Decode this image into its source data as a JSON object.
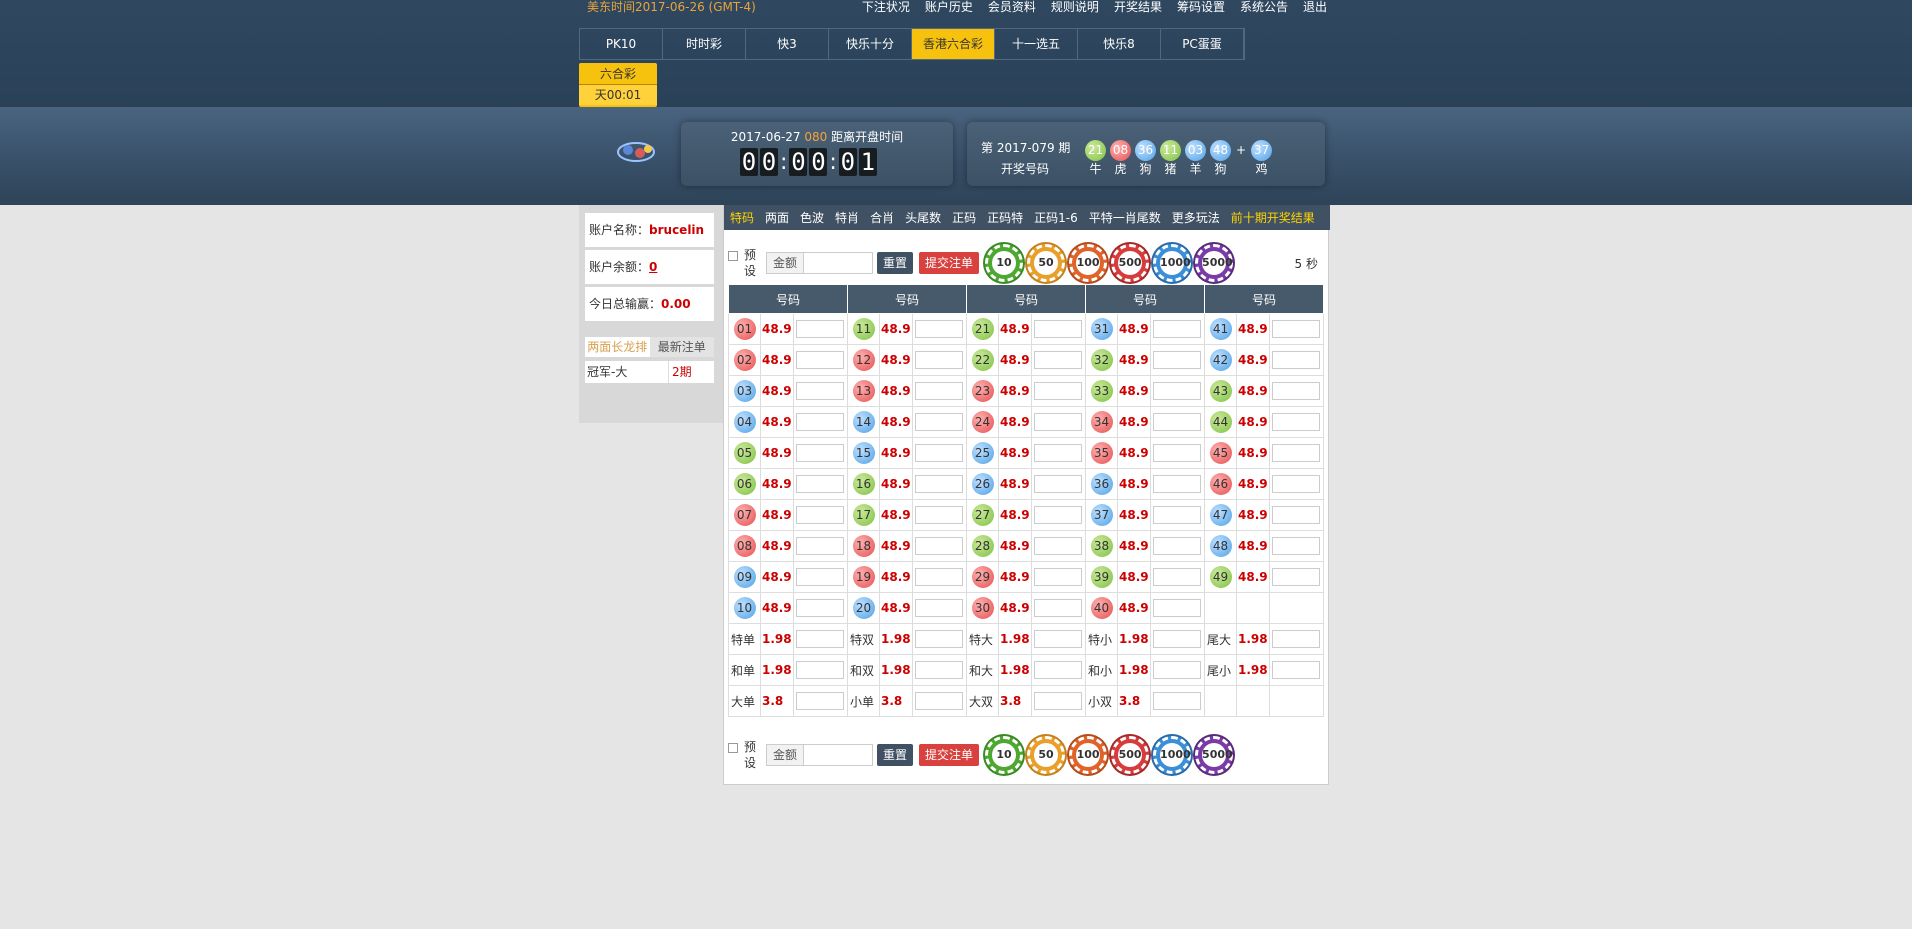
{
  "header": {
    "us_time": "美东时间2017-06-26 (GMT-4)",
    "nav": [
      "下注状况",
      "账户历史",
      "会员资料",
      "规则说明",
      "开奖结果",
      "筹码设置",
      "系统公告",
      "退出"
    ],
    "tabs": [
      "PK10",
      "时时彩",
      "快3",
      "快乐十分",
      "香港六合彩",
      "十一选五",
      "快乐8",
      "PC蛋蛋"
    ],
    "active_tab": "香港六合彩",
    "sub_tab": {
      "label": "六合彩",
      "time": "天00:01"
    }
  },
  "countdown": {
    "date": "2017-06-27",
    "period": "080",
    "label": "距离开盘时间",
    "digits": [
      "0",
      "0",
      "0",
      "0",
      "0",
      "1"
    ]
  },
  "result": {
    "title": "第 2017-079 期",
    "subtitle": "开奖号码",
    "balls": [
      {
        "num": "21",
        "zodiac": "牛",
        "color": "g"
      },
      {
        "num": "08",
        "zodiac": "虎",
        "color": "r"
      },
      {
        "num": "36",
        "zodiac": "狗",
        "color": "bl"
      },
      {
        "num": "11",
        "zodiac": "猪",
        "color": "g"
      },
      {
        "num": "03",
        "zodiac": "羊",
        "color": "bl"
      },
      {
        "num": "48",
        "zodiac": "狗",
        "color": "bl"
      }
    ],
    "plus": "+",
    "special": {
      "num": "37",
      "zodiac": "鸡",
      "color": "bl"
    }
  },
  "account": {
    "name_label": "账户名称：",
    "name": "brucelin",
    "balance_label": "账户余额：",
    "balance": "0",
    "today_label": "今日总输赢：",
    "today": "0.00",
    "tabs": [
      "两面长龙排",
      "最新注单"
    ],
    "row": {
      "name": "冠军-大",
      "value": "2期"
    }
  },
  "subnav": {
    "items": [
      "特码",
      "两面",
      "色波",
      "特肖",
      "合肖",
      "头尾数",
      "正码",
      "正码特",
      "正码1-6",
      "平特一肖尾数",
      "更多玩法",
      "前十期开奖结果"
    ],
    "active": "特码"
  },
  "bet_bar": {
    "preset": "预设",
    "amount": "金额",
    "reset": "重置",
    "submit": "提交注单",
    "chips": [
      "10",
      "50",
      "100",
      "500",
      "1000",
      "5000"
    ],
    "seconds": "5 秒"
  },
  "table": {
    "header": "号码",
    "odds": "48.9",
    "rows": [
      [
        {
          "n": "01",
          "c": "r"
        },
        {
          "n": "11",
          "c": "g"
        },
        {
          "n": "21",
          "c": "g"
        },
        {
          "n": "31",
          "c": "bl"
        },
        {
          "n": "41",
          "c": "bl"
        }
      ],
      [
        {
          "n": "02",
          "c": "r"
        },
        {
          "n": "12",
          "c": "r"
        },
        {
          "n": "22",
          "c": "g"
        },
        {
          "n": "32",
          "c": "g"
        },
        {
          "n": "42",
          "c": "bl"
        }
      ],
      [
        {
          "n": "03",
          "c": "bl"
        },
        {
          "n": "13",
          "c": "r"
        },
        {
          "n": "23",
          "c": "r"
        },
        {
          "n": "33",
          "c": "g"
        },
        {
          "n": "43",
          "c": "g"
        }
      ],
      [
        {
          "n": "04",
          "c": "bl"
        },
        {
          "n": "14",
          "c": "bl"
        },
        {
          "n": "24",
          "c": "r"
        },
        {
          "n": "34",
          "c": "r"
        },
        {
          "n": "44",
          "c": "g"
        }
      ],
      [
        {
          "n": "05",
          "c": "g"
        },
        {
          "n": "15",
          "c": "bl"
        },
        {
          "n": "25",
          "c": "bl"
        },
        {
          "n": "35",
          "c": "r"
        },
        {
          "n": "45",
          "c": "r"
        }
      ],
      [
        {
          "n": "06",
          "c": "g"
        },
        {
          "n": "16",
          "c": "g"
        },
        {
          "n": "26",
          "c": "bl"
        },
        {
          "n": "36",
          "c": "bl"
        },
        {
          "n": "46",
          "c": "r"
        }
      ],
      [
        {
          "n": "07",
          "c": "r"
        },
        {
          "n": "17",
          "c": "g"
        },
        {
          "n": "27",
          "c": "g"
        },
        {
          "n": "37",
          "c": "bl"
        },
        {
          "n": "47",
          "c": "bl"
        }
      ],
      [
        {
          "n": "08",
          "c": "r"
        },
        {
          "n": "18",
          "c": "r"
        },
        {
          "n": "28",
          "c": "g"
        },
        {
          "n": "38",
          "c": "g"
        },
        {
          "n": "48",
          "c": "bl"
        }
      ],
      [
        {
          "n": "09",
          "c": "bl"
        },
        {
          "n": "19",
          "c": "r"
        },
        {
          "n": "29",
          "c": "r"
        },
        {
          "n": "39",
          "c": "g"
        },
        {
          "n": "49",
          "c": "g"
        }
      ],
      [
        {
          "n": "10",
          "c": "bl"
        },
        {
          "n": "20",
          "c": "bl"
        },
        {
          "n": "30",
          "c": "r"
        },
        {
          "n": "40",
          "c": "r"
        }
      ]
    ],
    "two_sided": [
      [
        {
          "l": "特单",
          "o": "1.98"
        },
        {
          "l": "特双",
          "o": "1.98"
        },
        {
          "l": "特大",
          "o": "1.98"
        },
        {
          "l": "特小",
          "o": "1.98"
        },
        {
          "l": "尾大",
          "o": "1.98"
        }
      ],
      [
        {
          "l": "和单",
          "o": "1.98"
        },
        {
          "l": "和双",
          "o": "1.98"
        },
        {
          "l": "和大",
          "o": "1.98"
        },
        {
          "l": "和小",
          "o": "1.98"
        },
        {
          "l": "尾小",
          "o": "1.98"
        }
      ],
      [
        {
          "l": "大单",
          "o": "3.8"
        },
        {
          "l": "小单",
          "o": "3.8"
        },
        {
          "l": "大双",
          "o": "3.8"
        },
        {
          "l": "小双",
          "o": "3.8"
        }
      ]
    ]
  },
  "colors": {
    "g": "#7fc144",
    "r": "#e64f4f",
    "bl": "#4ea1e6",
    "accent": "#f7c20d",
    "header": "#2f4860"
  }
}
